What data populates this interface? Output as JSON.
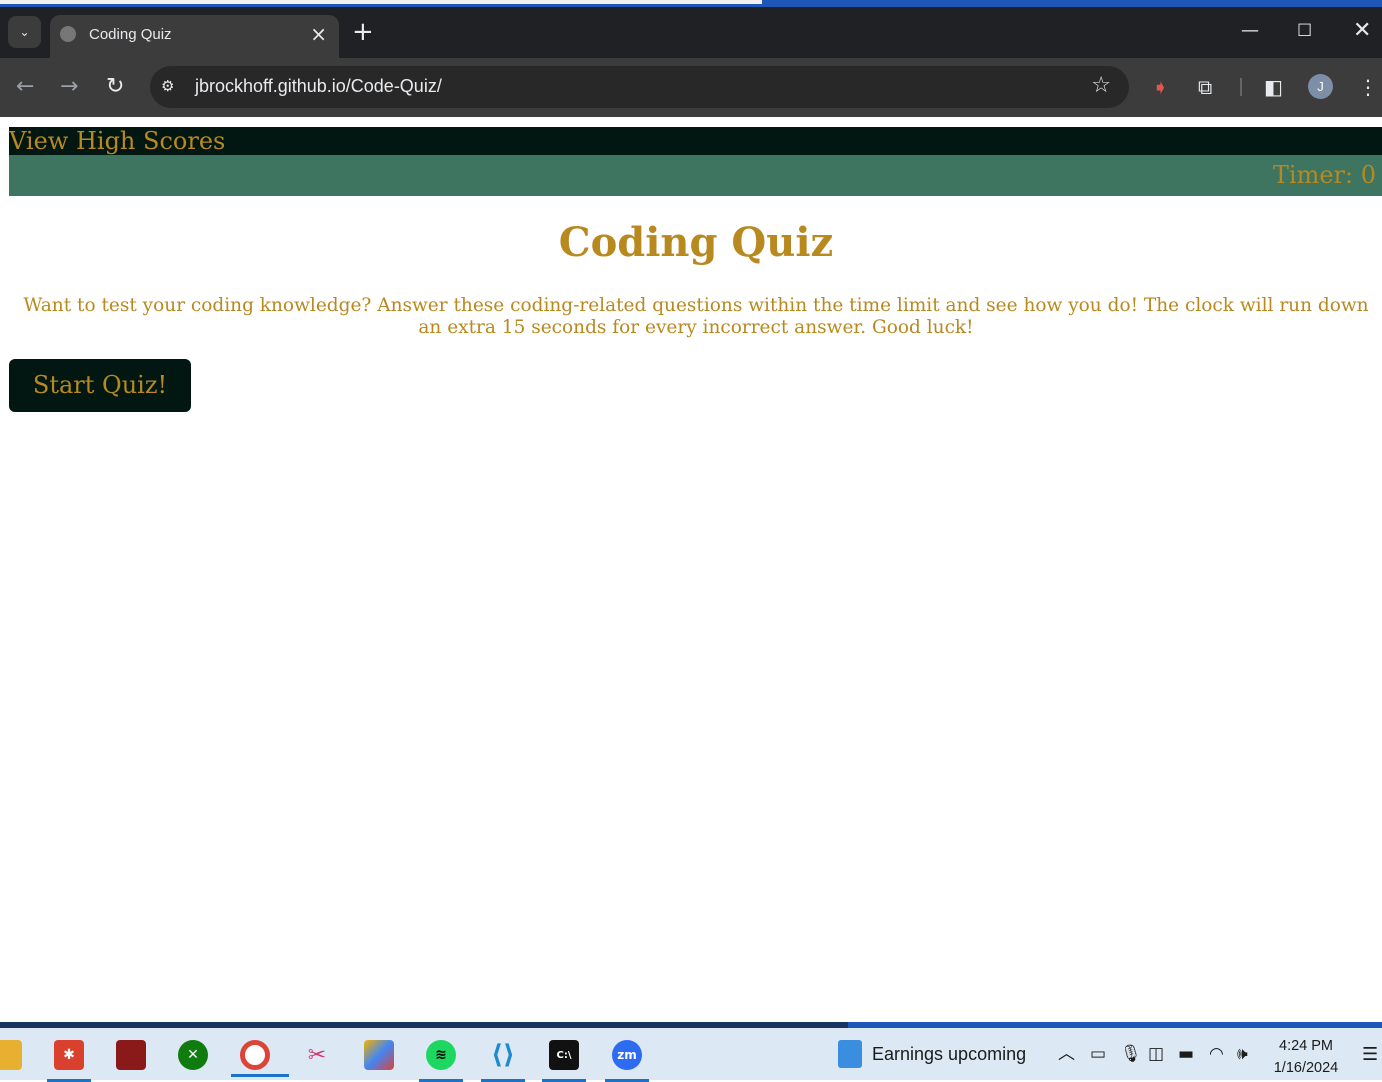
{
  "browser": {
    "tab_title": "Coding Quiz",
    "url_domain": "jbrockhoff.github.io",
    "url_path": "/Code-Quiz/",
    "profile_initial": "J"
  },
  "page": {
    "high_scores_link": "View High Scores",
    "timer_text": "Timer: 0",
    "title": "Coding Quiz",
    "intro": "Want to test your coding knowledge? Answer these coding-related questions within the time limit and see how you do! The clock will run down an extra 15 seconds for every incorrect answer. Good luck!",
    "start_button": "Start Quiz!",
    "colors": {
      "gold": "#b8891f",
      "dark_green": "#021712",
      "mid_green": "#3e7560"
    }
  },
  "taskbar": {
    "apps": [
      "file-explorer-icon",
      "app-red-icon",
      "app-dark-red-icon",
      "xbox-icon",
      "chrome-icon",
      "snipping-tool-icon",
      "app-colorful-icon",
      "spotify-icon",
      "vscode-icon",
      "terminal-icon",
      "zoom-icon"
    ],
    "news_text": "Earnings upcoming",
    "time": "4:24 PM",
    "date": "1/16/2024"
  }
}
